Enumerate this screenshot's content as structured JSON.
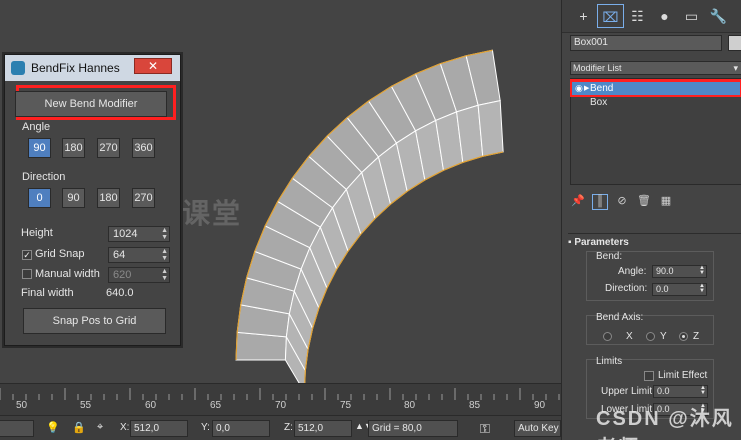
{
  "dialog": {
    "title": "BendFix Hannes",
    "close_label": "✕",
    "new_bend_label": "New Bend Modifier",
    "angle_label": "Angle",
    "angle_options": [
      "90",
      "180",
      "270",
      "360"
    ],
    "angle_selected": "90",
    "direction_label": "Direction",
    "direction_options": [
      "0",
      "90",
      "180",
      "270"
    ],
    "direction_selected": "0",
    "height_label": "Height",
    "height_value": "1024",
    "grid_snap_label": "Grid Snap",
    "grid_snap_checked": true,
    "grid_snap_value": "64",
    "manual_width_label": "Manual width",
    "manual_width_checked": false,
    "manual_width_value": "620",
    "final_width_label": "Final width",
    "final_width_value": "640.0",
    "snap_button_label": "Snap Pos to Grid"
  },
  "panel": {
    "tabs": [
      "+",
      "⌧",
      "☷",
      "●",
      "▭",
      "🔧"
    ],
    "object_name": "Box001",
    "modifier_list_label": "Modifier List",
    "stack_items": [
      "Bend",
      "Box"
    ],
    "stack_tools": [
      "📌",
      "║",
      "⊘",
      "🗑",
      "▦"
    ],
    "parameters_title": "Parameters",
    "bend_label": "Bend:",
    "angle_label": "Angle:",
    "angle_value": "90.0",
    "direction_label": "Direction:",
    "direction_value": "0.0",
    "bend_axis_label": "Bend Axis:",
    "axis_x": "X",
    "axis_y": "Y",
    "axis_z": "Z",
    "limits_label": "Limits",
    "limit_effect_label": "Limit Effect",
    "upper_limit_label": "Upper Limit:",
    "upper_limit_value": "0.0",
    "lower_limit_label": "Lower Limit:",
    "lower_limit_value": "0.0"
  },
  "ruler": {
    "ticks": [
      "50",
      "55",
      "60",
      "65",
      "70",
      "75",
      "80",
      "85",
      "90"
    ]
  },
  "status": {
    "x_label": "X:",
    "x_value": "512,0",
    "y_label": "Y:",
    "y_value": "0,0",
    "z_label": "Z:",
    "z_value": "512,0",
    "grid_text": "Grid = 80,0",
    "auto_key_label": "Auto Key"
  },
  "watermarks": {
    "center": "沐风课堂",
    "corner": "CSDN @沐风老师"
  },
  "colors": {
    "highlight_outline": "#ff2020",
    "selected_blue": "#4f88c7",
    "mesh_edge": "#e0a030"
  }
}
